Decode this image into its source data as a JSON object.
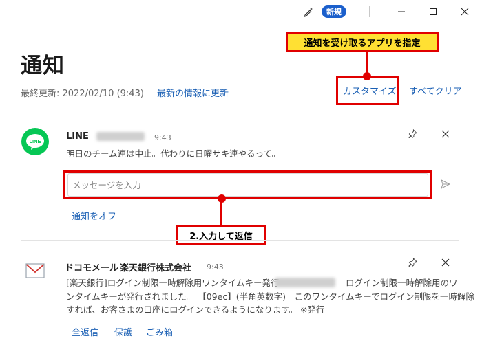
{
  "titlebar": {
    "badge": "新規",
    "icons": [
      "pen-sparkle-icon",
      "minimize-icon",
      "maximize-icon",
      "close-icon"
    ]
  },
  "header": {
    "title": "通知",
    "last_updated": "最終更新: 2022/02/10 (9:43)",
    "refresh_link": "最新の情報に更新",
    "customize_link": "カスタマイズ",
    "clear_all_link": "すべてクリア"
  },
  "annotations": {
    "callout_customize": "通知を受け取るアプリを指定",
    "callout_reply": "2.入力して返信",
    "color": "#e00000",
    "callout_fill": "#ffe033"
  },
  "notifications": [
    {
      "app": "LINE",
      "icon": "line-logo-icon",
      "time": "9:43",
      "message": "明日のチーム連は中止。代わりに日曜サキ連やるって。",
      "reply_placeholder": "メッセージを入力",
      "actions": [
        "通知をオフ"
      ]
    },
    {
      "app": "ドコモメール",
      "sender": "楽天銀行株式会社",
      "icon": "mail-envelope-icon",
      "time": "9:43",
      "message_line1": "[楽天銀行]ログイン制限一時解除用ワンタイムキー発行",
      "message_line1b": "ログイン制限一時解除用のワ",
      "message_line2": "ンタイムキーが発行されました。 【09ec】(半角英数字)　このワンタイムキーでログイン制限を一時解除",
      "message_line3": "すれば、お客さまの口座にログインできるようになります。 ※発行",
      "actions": [
        "全返信",
        "保護",
        "ごみ箱"
      ]
    }
  ],
  "colors": {
    "accent": "#1a5fb4",
    "badge": "#1b5fcc",
    "line_green": "#06c755"
  }
}
